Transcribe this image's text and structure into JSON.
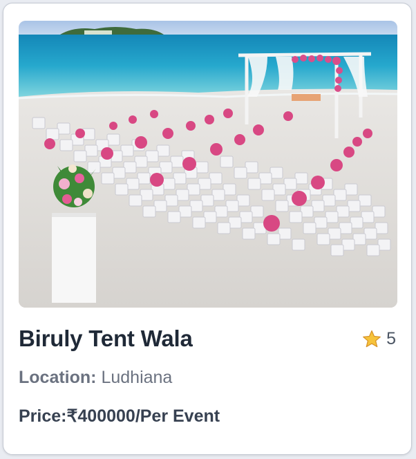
{
  "card": {
    "title": "Biruly Tent Wala",
    "rating": "5",
    "rating_icon": "star-icon",
    "location_label": "Location:",
    "location_value": "Ludhiana",
    "price_label": "Price:",
    "price_value": "₹400000/Per Event"
  },
  "colors": {
    "title": "#1f2937",
    "muted": "#6b7280",
    "star": "#f6c33b",
    "sea": "#2aa7c9",
    "sand": "#dddad6"
  }
}
